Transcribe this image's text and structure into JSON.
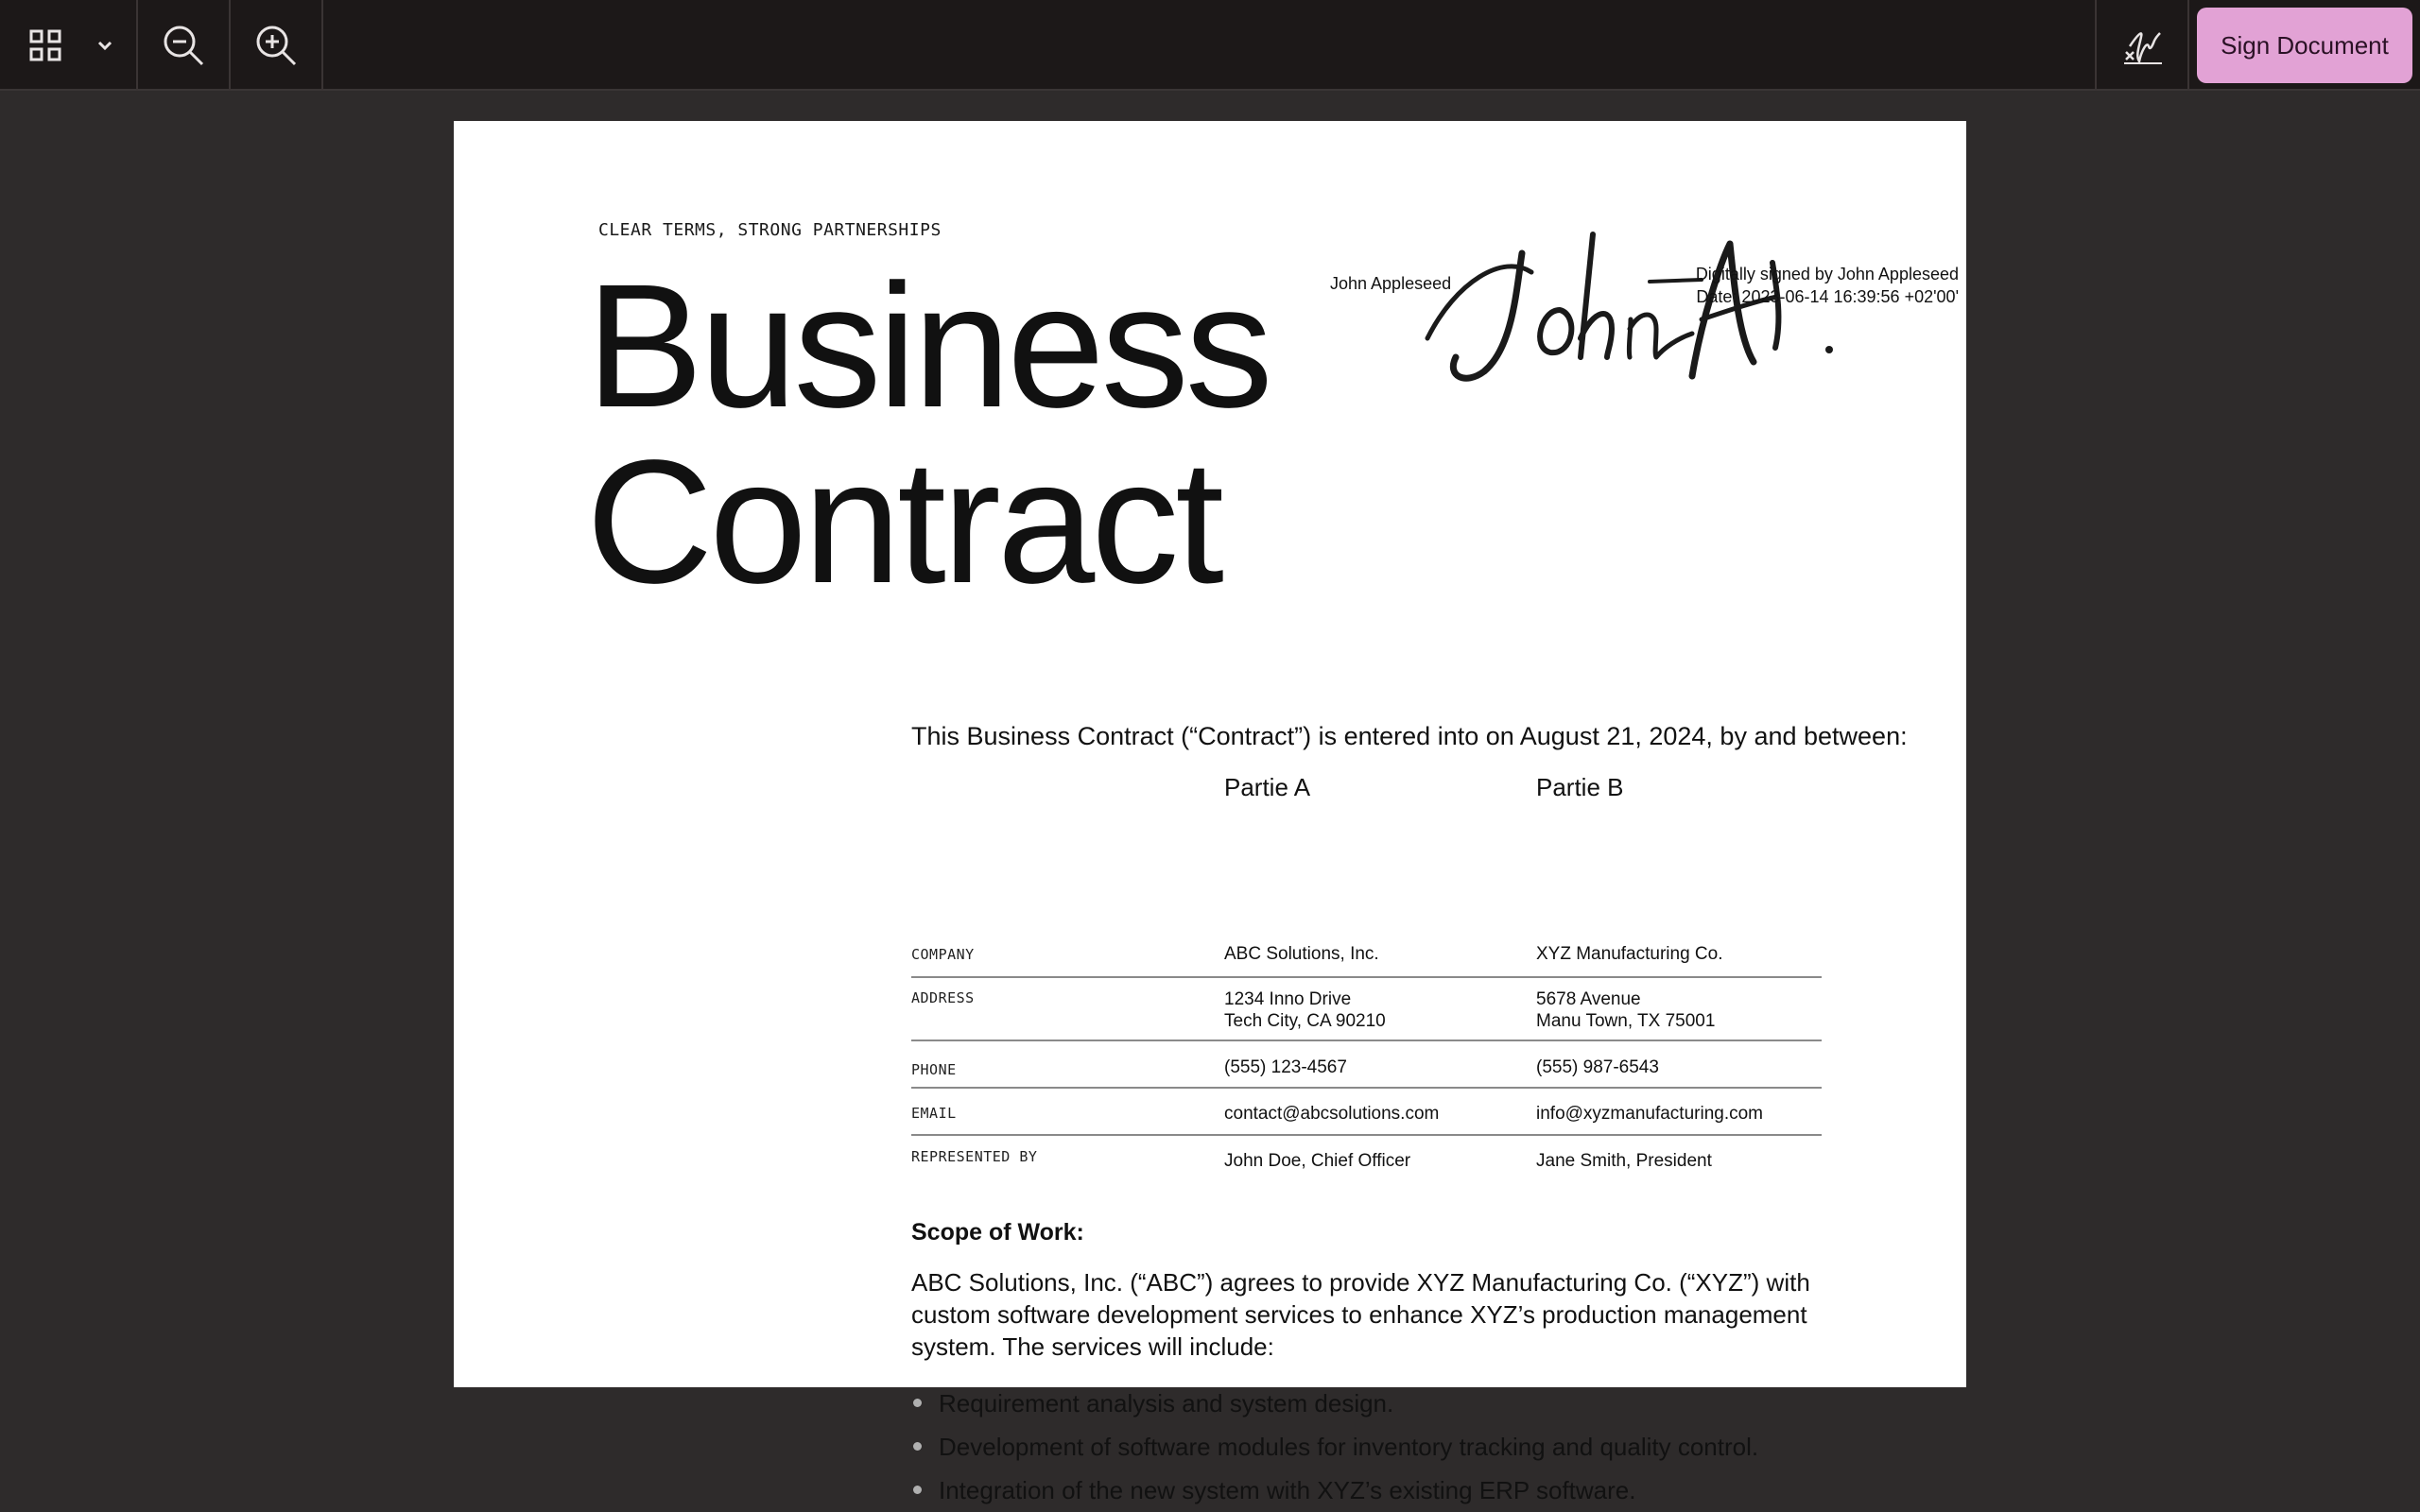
{
  "toolbar": {
    "grid_icon": "grid-icon",
    "dropdown_icon": "chevron-down-icon",
    "zoom_out_icon": "zoom-out-icon",
    "zoom_in_icon": "zoom-in-icon",
    "signature_icon": "signature-icon",
    "sign_button_label": "Sign Document",
    "accent_color": "#e2a2d5"
  },
  "document": {
    "tagline": "CLEAR TERMS, STRONG PARTNERSHIPS",
    "title_line1": "Business",
    "title_line2": "Contract",
    "signature": {
      "name": "John Appleseed",
      "signed_by": "Digitally signed by John Appleseed",
      "date": "Date: 2023-06-14 16:39:56 +02'00'"
    },
    "intro": "This Business Contract (“Contract”) is entered into on August 21, 2024, by and between:",
    "parties": {
      "party_a": "Partie A",
      "party_b": "Partie B",
      "rows": [
        {
          "label": "COMPANY",
          "a": "ABC Solutions, Inc.",
          "b": "XYZ Manufacturing Co."
        },
        {
          "label": "ADDRESS",
          "a1": "1234 Inno Drive",
          "a2": "Tech City, CA 90210",
          "b1": "5678 Avenue",
          "b2": "Manu Town, TX 75001"
        },
        {
          "label": "PHONE",
          "a": "(555) 123-4567",
          "b": "(555) 987-6543"
        },
        {
          "label": "EMAIL",
          "a": "contact@abcsolutions.com",
          "b": "info@xyzmanufacturing.com"
        },
        {
          "label": "REPRESENTED BY",
          "a": "John Doe, Chief Officer",
          "b": "Jane Smith, President"
        }
      ]
    },
    "scope_title": "Scope of Work:",
    "scope_text": "ABC Solutions, Inc. (“ABC”) agrees to provide XYZ Manufacturing Co. (“XYZ”) with custom software development services to enhance XYZ’s production management system. The services will include:",
    "bullets": [
      "Requirement analysis and system design.",
      "Development of software modules for inventory tracking and quality control.",
      "Integration of the new system with XYZ’s existing ERP software."
    ]
  }
}
